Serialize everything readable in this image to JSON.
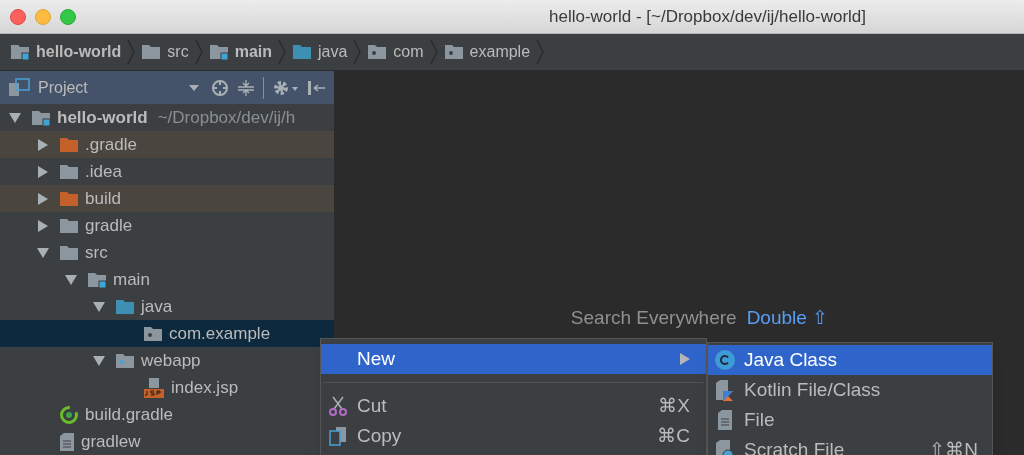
{
  "window": {
    "title": "hello-world - [~/Dropbox/dev/ij/hello-world]"
  },
  "breadcrumbs": [
    {
      "name": "hello-world",
      "kind": "module",
      "bold": true
    },
    {
      "name": "src",
      "kind": "folder",
      "bold": false
    },
    {
      "name": "main",
      "kind": "module",
      "bold": true
    },
    {
      "name": "java",
      "kind": "source",
      "bold": false
    },
    {
      "name": "com",
      "kind": "package",
      "bold": false
    },
    {
      "name": "example",
      "kind": "package",
      "bold": false
    }
  ],
  "tool_window": {
    "title": "Project"
  },
  "tree": [
    {
      "name": "hello-world",
      "hint": "~/Dropbox/dev/ij/h",
      "kind": "module",
      "bold": true,
      "expanded": true,
      "excluded": false,
      "selected": false,
      "children": [
        {
          "name": ".gradle",
          "kind": "excluded",
          "bold": false,
          "expanded": false,
          "excluded": true,
          "selected": false
        },
        {
          "name": ".idea",
          "kind": "folder",
          "bold": false,
          "expanded": false,
          "excluded": false,
          "selected": false
        },
        {
          "name": "build",
          "kind": "excluded",
          "bold": false,
          "expanded": false,
          "excluded": true,
          "selected": false
        },
        {
          "name": "gradle",
          "kind": "folder",
          "bold": false,
          "expanded": false,
          "excluded": false,
          "selected": false
        },
        {
          "name": "src",
          "kind": "folder",
          "bold": false,
          "expanded": true,
          "excluded": false,
          "selected": false,
          "children": [
            {
              "name": "main",
              "kind": "module",
              "bold": false,
              "expanded": true,
              "excluded": false,
              "selected": false,
              "children": [
                {
                  "name": "java",
                  "kind": "source",
                  "bold": false,
                  "expanded": true,
                  "excluded": false,
                  "selected": false,
                  "children": [
                    {
                      "name": "com.example",
                      "kind": "package",
                      "bold": false,
                      "excluded": false,
                      "selected": true
                    }
                  ]
                },
                {
                  "name": "webapp",
                  "kind": "web",
                  "bold": false,
                  "expanded": true,
                  "excluded": false,
                  "selected": false,
                  "children": [
                    {
                      "name": "index.jsp",
                      "kind": "jsp",
                      "bold": false,
                      "excluded": false,
                      "selected": false
                    }
                  ]
                }
              ]
            }
          ]
        },
        {
          "name": "build.gradle",
          "kind": "gradle",
          "bold": false,
          "excluded": false,
          "selected": false
        },
        {
          "name": "gradlew",
          "kind": "file",
          "bold": false,
          "excluded": false,
          "selected": false
        }
      ]
    }
  ],
  "editor_hint": {
    "label": "Search Everywhere",
    "shortcut": "Double ⇧"
  },
  "context_menu": [
    {
      "kind": "item",
      "label": "New",
      "submenu": true,
      "selected": true
    },
    {
      "kind": "separator"
    },
    {
      "kind": "item",
      "label": "Cut",
      "shortcut": "⌘X",
      "submenu": false,
      "selected": false
    },
    {
      "kind": "item",
      "label": "Copy",
      "shortcut": "⌘C",
      "submenu": false,
      "selected": false
    }
  ],
  "submenu": [
    {
      "label": "Java Class",
      "selected": true
    },
    {
      "label": "Kotlin File/Class",
      "selected": false
    },
    {
      "label": "File",
      "selected": false
    },
    {
      "label": "Scratch File",
      "shortcut": "⇧⌘N",
      "selected": false
    }
  ]
}
